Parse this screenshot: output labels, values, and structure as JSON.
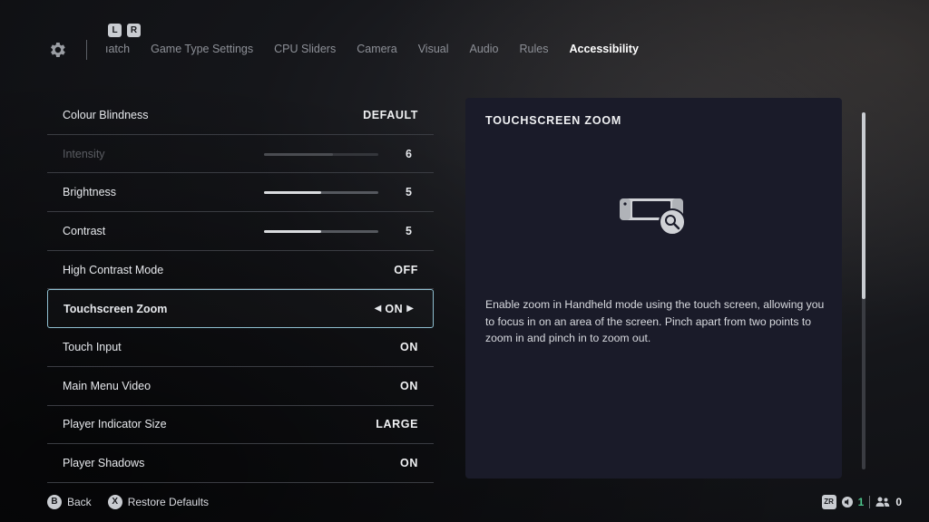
{
  "nav": {
    "shoulder_left": "L",
    "shoulder_right": "R",
    "tabs": [
      {
        "label": "Match",
        "visible_label": "ıatch"
      },
      {
        "label": "Game Type Settings"
      },
      {
        "label": "CPU Sliders"
      },
      {
        "label": "Camera"
      },
      {
        "label": "Visual"
      },
      {
        "label": "Audio"
      },
      {
        "label": "Rules"
      },
      {
        "label": "Accessibility"
      }
    ],
    "active_tab": "Accessibility"
  },
  "settings": [
    {
      "label": "Colour Blindness",
      "value": "DEFAULT"
    },
    {
      "label": "Intensity",
      "value": "6",
      "slider": 0.6,
      "disabled": true
    },
    {
      "label": "Brightness",
      "value": "5",
      "slider": 0.5
    },
    {
      "label": "Contrast",
      "value": "5",
      "slider": 0.5
    },
    {
      "label": "High Contrast Mode",
      "value": "OFF"
    },
    {
      "label": "Touchscreen Zoom",
      "value": "ON",
      "selected": true
    },
    {
      "label": "Touch Input",
      "value": "ON"
    },
    {
      "label": "Main Menu Video",
      "value": "ON"
    },
    {
      "label": "Player Indicator Size",
      "value": "LARGE"
    },
    {
      "label": "Player Shadows",
      "value": "ON"
    }
  ],
  "panel": {
    "title": "TOUCHSCREEN ZOOM",
    "icon": "handheld-zoom-icon",
    "description": "Enable zoom in Handheld mode using the touch screen, allowing you to focus in on an area of the screen. Pinch apart from two points to zoom in and pinch in to zoom out."
  },
  "footer": {
    "back_button": "B",
    "back_label": "Back",
    "restore_button": "X",
    "restore_label": "Restore Defaults"
  },
  "status": {
    "zr_label": "ZR",
    "speaker_count": "1",
    "party_count": "0"
  },
  "colors": {
    "accent_selected_border": "#8fbfd0",
    "panel_bg": "#1a1b29",
    "status_green": "#4cc38a"
  }
}
